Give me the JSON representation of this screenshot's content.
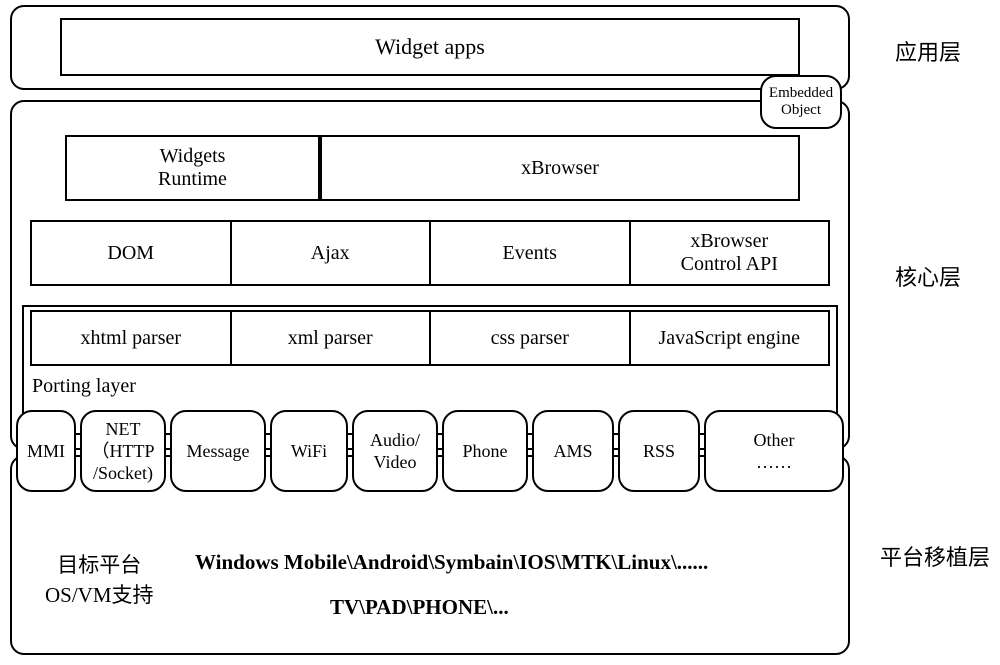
{
  "layers": {
    "application": "应用层",
    "core": "核心层",
    "platform": "平台移植层"
  },
  "app": {
    "widget_apps": "Widget apps",
    "embedded_object_l1": "Embedded",
    "embedded_object_l2": "Object"
  },
  "core": {
    "widgets_runtime_l1": "Widgets",
    "widgets_runtime_l2": "Runtime",
    "xbrowser": "xBrowser",
    "dom": "DOM",
    "ajax": "Ajax",
    "events": "Events",
    "xbrowser_api_l1": "xBrowser",
    "xbrowser_api_l2": "Control API",
    "xhtml_parser": "xhtml parser",
    "xml_parser": "xml parser",
    "css_parser": "css parser",
    "js_engine": "JavaScript engine",
    "porting_layer": "Porting layer"
  },
  "modules": {
    "mmi": "MMI",
    "net_l1": "NET",
    "net_l2": "（HTTP",
    "net_l3": "/Socket)",
    "message": "Message",
    "wifi": "WiFi",
    "av_l1": "Audio/",
    "av_l2": "Video",
    "phone": "Phone",
    "ams": "AMS",
    "rss": "RSS",
    "other_l1": "Other",
    "other_l2": "……"
  },
  "platform": {
    "os_support_l1": "目标平台",
    "os_support_l2": "OS/VM支持",
    "list1": "Windows Mobile\\Android\\Symbain\\IOS\\MTK\\Linux\\......",
    "list2": "TV\\PAD\\PHONE\\..."
  }
}
